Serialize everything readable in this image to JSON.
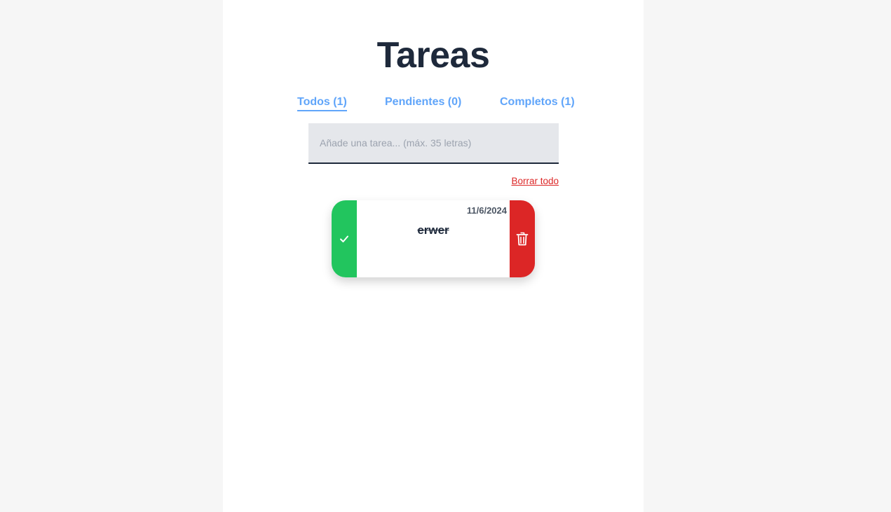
{
  "app": {
    "title": "Tareas"
  },
  "tabs": [
    {
      "label": "Todos (1)",
      "active": true
    },
    {
      "label": "Pendientes (0)",
      "active": false
    },
    {
      "label": "Completos (1)",
      "active": false
    }
  ],
  "new_task": {
    "value": "",
    "placeholder": "Añade una tarea... (máx. 35 letras)"
  },
  "actions": {
    "clear_all_label": "Borrar todo"
  },
  "tasks": [
    {
      "text": "erwer",
      "date": "11/6/2024",
      "completed": true,
      "complete_icon": "check-icon",
      "delete_icon": "trash-icon"
    }
  ],
  "colors": {
    "title": "#1e293b",
    "tab": "#60a5fa",
    "complete": "#22c55e",
    "delete": "#dc2626",
    "input_bg": "#e5e7eb"
  }
}
